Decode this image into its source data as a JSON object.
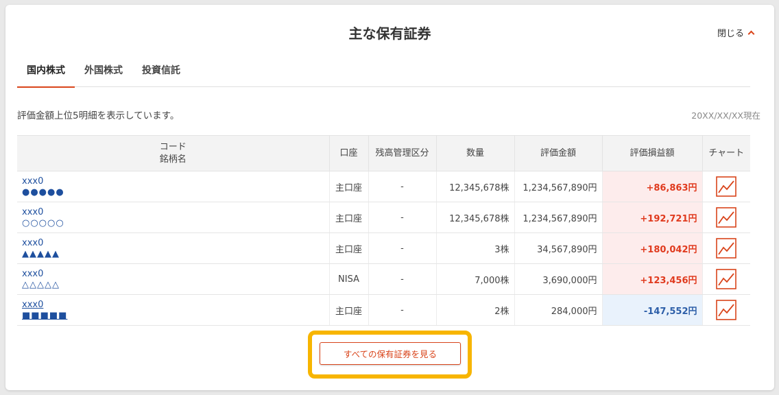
{
  "header": {
    "title": "主な保有証券",
    "close_label": "閉じる"
  },
  "tabs": [
    {
      "label": "国内株式",
      "active": true
    },
    {
      "label": "外国株式",
      "active": false
    },
    {
      "label": "投資信託",
      "active": false
    }
  ],
  "summary": {
    "note": "評価金額上位5明細を表示しています。",
    "as_of": "20XX/XX/XX現在"
  },
  "table": {
    "headers": {
      "name_line1": "コード",
      "name_line2": "銘柄名",
      "account": "口座",
      "category": "残高管理区分",
      "quantity": "数量",
      "value": "評価金額",
      "pl": "評価損益額",
      "chart": "チャート"
    },
    "rows": [
      {
        "code": "xxx0",
        "name": "●●●●●",
        "account": "主口座",
        "category": "-",
        "quantity": "12,345,678株",
        "value": "1,234,567,890円",
        "pl": "+86,863円"
      },
      {
        "code": "xxx0",
        "name": "○○○○○",
        "account": "主口座",
        "category": "-",
        "quantity": "12,345,678株",
        "value": "1,234,567,890円",
        "pl": "+192,721円"
      },
      {
        "code": "xxx0",
        "name": "▲▲▲▲▲",
        "account": "主口座",
        "category": "-",
        "quantity": "3株",
        "value": "34,567,890円",
        "pl": "+180,042円"
      },
      {
        "code": "xxx0",
        "name": "△△△△△",
        "account": "NISA",
        "category": "-",
        "quantity": "7,000株",
        "value": "3,690,000円",
        "pl": "+123,456円"
      },
      {
        "code": "xxx0",
        "name": "■■■■■",
        "account": "主口座",
        "category": "-",
        "quantity": "2株",
        "value": "284,000円",
        "pl": "-147,552円"
      }
    ]
  },
  "footer": {
    "view_all_label": "すべての保有証券を見る"
  },
  "colors": {
    "accent": "#d9441a",
    "positive": "#e03a1e",
    "negative": "#2c5ea8",
    "highlight": "#f7b500"
  }
}
